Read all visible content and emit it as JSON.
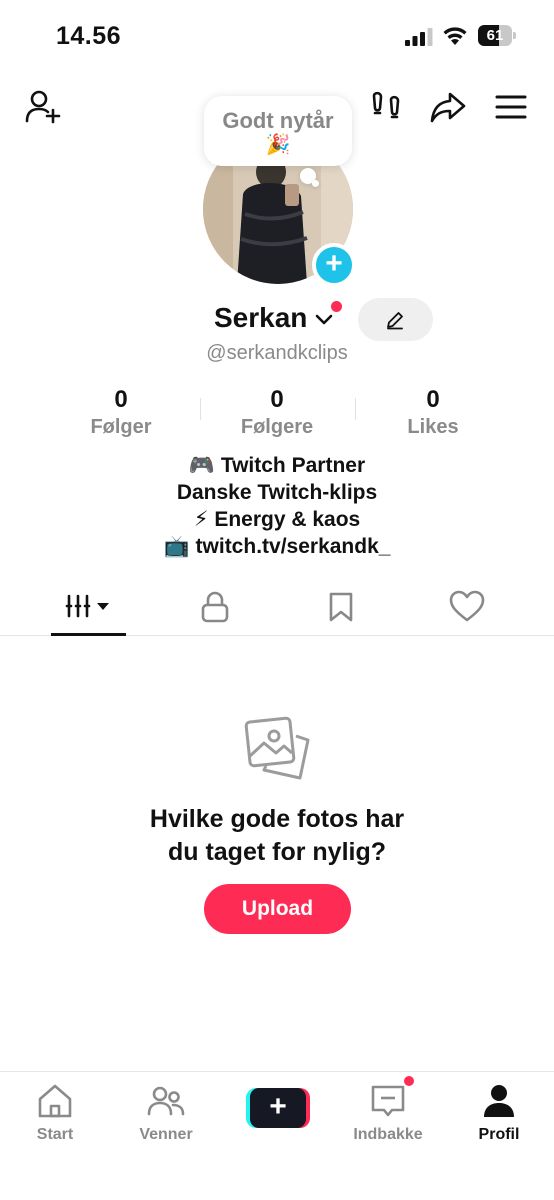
{
  "status_bar": {
    "time": "14.56",
    "battery": "61",
    "battery_level": 0.61
  },
  "header": {
    "icons": [
      "add-friend-icon",
      "footprints-icon",
      "share-icon",
      "menu-icon"
    ]
  },
  "note": {
    "text": "Godt nytår",
    "emoji": "🎉"
  },
  "profile": {
    "name": "Serkan",
    "handle": "@serkandkclips",
    "has_notification_dot": true
  },
  "stats": [
    {
      "value": "0",
      "label": "Følger"
    },
    {
      "value": "0",
      "label": "Følgere"
    },
    {
      "value": "0",
      "label": "Likes"
    }
  ],
  "bio": [
    "🎮 Twitch Partner",
    "Danske Twitch-klips",
    "⚡ Energy & kaos",
    "📺 twitch.tv/serkandk_"
  ],
  "tabs": [
    "videos-grid-icon",
    "lock-icon",
    "bookmark-icon",
    "heart-icon"
  ],
  "empty_state": {
    "title_line1": "Hvilke gode fotos har",
    "title_line2": "du taget for nylig?",
    "button": "Upload"
  },
  "bottom_nav": {
    "start": "Start",
    "venner": "Venner",
    "indbakke": "Indbakke",
    "profil": "Profil"
  },
  "colors": {
    "accent": "#fe2c55",
    "cyan": "#25f4ee",
    "avatar_add": "#1fc2e8"
  }
}
